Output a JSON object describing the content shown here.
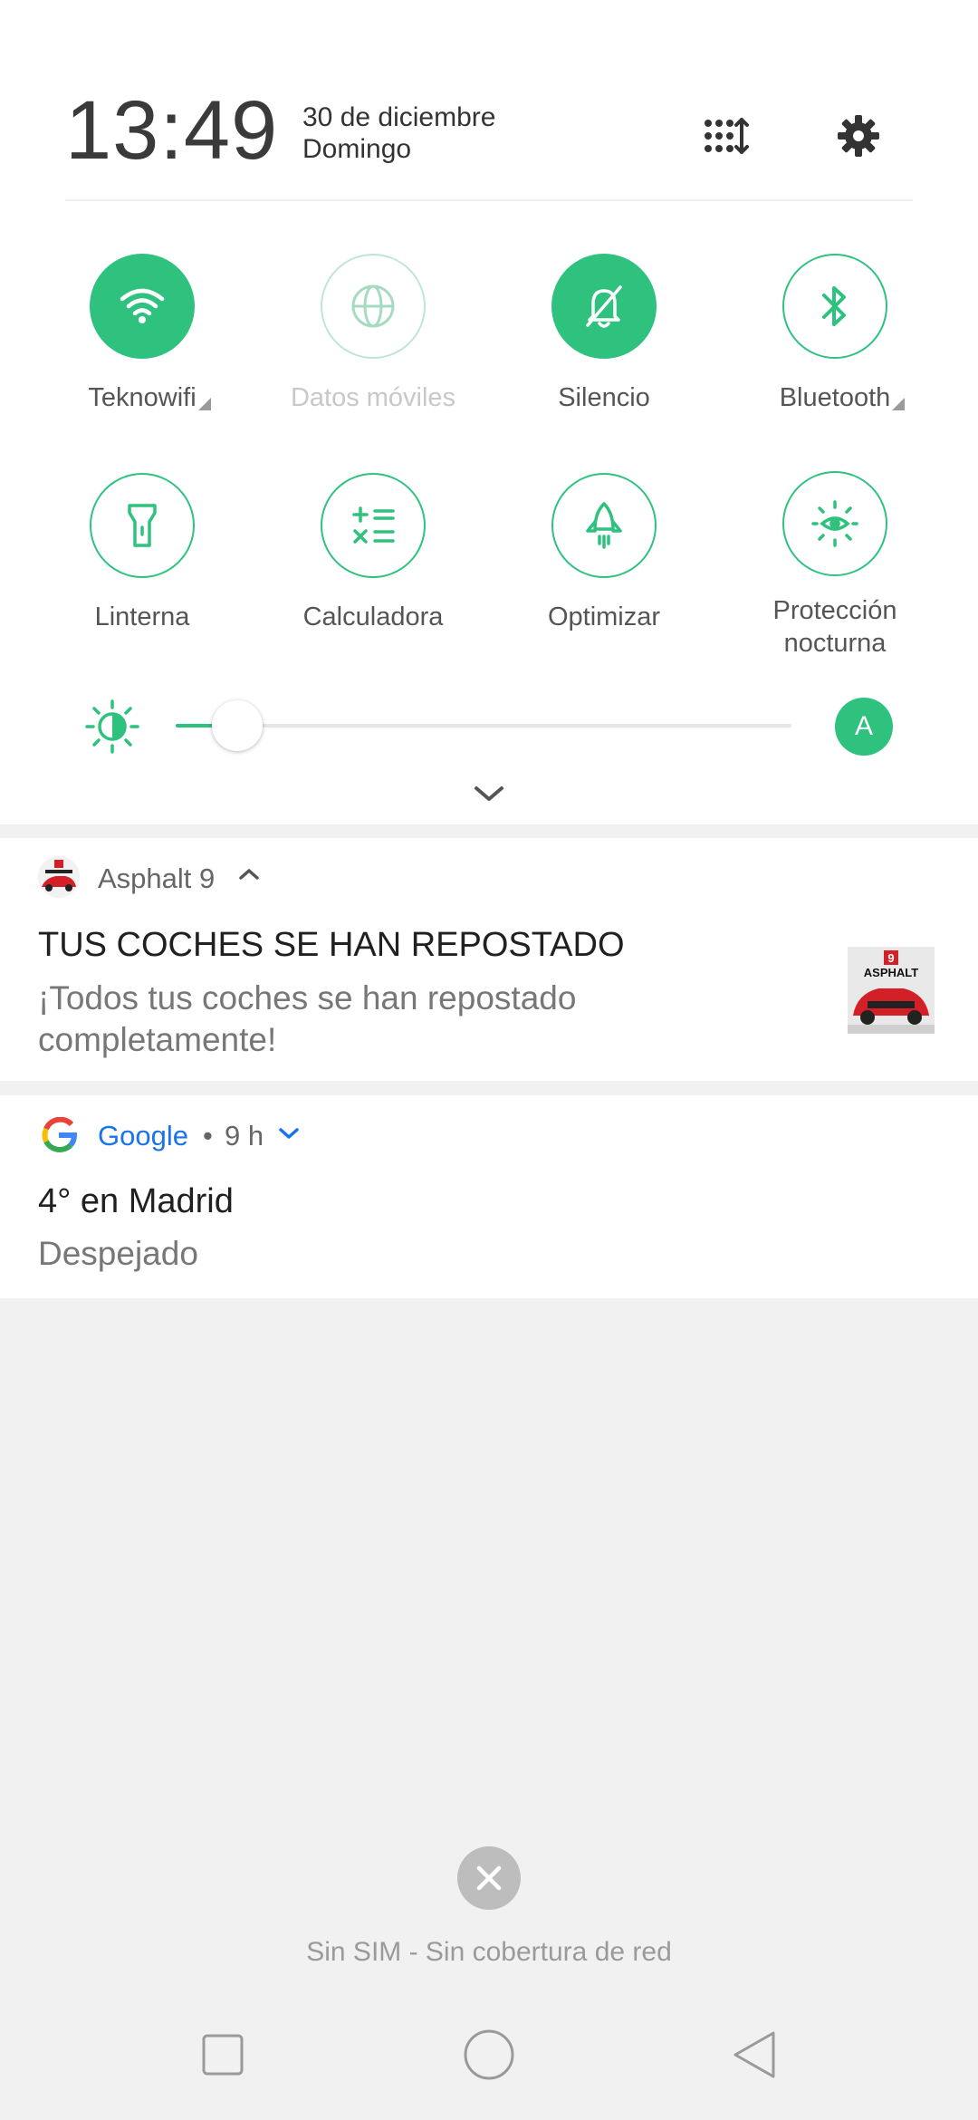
{
  "header": {
    "time": "13:49",
    "date": "30 de diciembre",
    "weekday": "Domingo",
    "icons": [
      "edit-tiles-icon",
      "gear-icon"
    ]
  },
  "quick_settings": {
    "row1": [
      {
        "label": "Teknowifi",
        "icon": "wifi-icon",
        "state": "on"
      },
      {
        "label": "Datos móviles",
        "icon": "globe-icon",
        "state": "disabled"
      },
      {
        "label": "Silencio",
        "icon": "bell-off-icon",
        "state": "on"
      },
      {
        "label": "Bluetooth",
        "icon": "bluetooth-icon",
        "state": "off"
      }
    ],
    "row2": [
      {
        "label": "Linterna",
        "icon": "flashlight-icon",
        "state": "off"
      },
      {
        "label": "Calculadora",
        "icon": "calculator-icon",
        "state": "off"
      },
      {
        "label": "Optimizar",
        "icon": "rocket-icon",
        "state": "off"
      },
      {
        "label_line1": "Protección",
        "label_line2": "nocturna",
        "icon": "eye-protection-icon",
        "state": "off"
      }
    ]
  },
  "brightness": {
    "level": 0.1,
    "auto_label": "A"
  },
  "notifications": [
    {
      "app": "Asphalt 9",
      "title": "TUS COCHES SE HAN REPOSTADO",
      "text_line1": "¡Todos tus coches se han repostado",
      "text_line2": "completamente!",
      "thumb_label": "ASPHALT",
      "thumb_badge": "9"
    },
    {
      "app": "Google",
      "age": "9 h",
      "separator": "•",
      "title": "4° en Madrid",
      "text": "Despejado"
    }
  ],
  "sim_status": "Sin SIM - Sin cobertura de red",
  "colors": {
    "accent": "#2ec27e",
    "google_blue": "#1a73e8",
    "background": "#f1f1f1"
  }
}
